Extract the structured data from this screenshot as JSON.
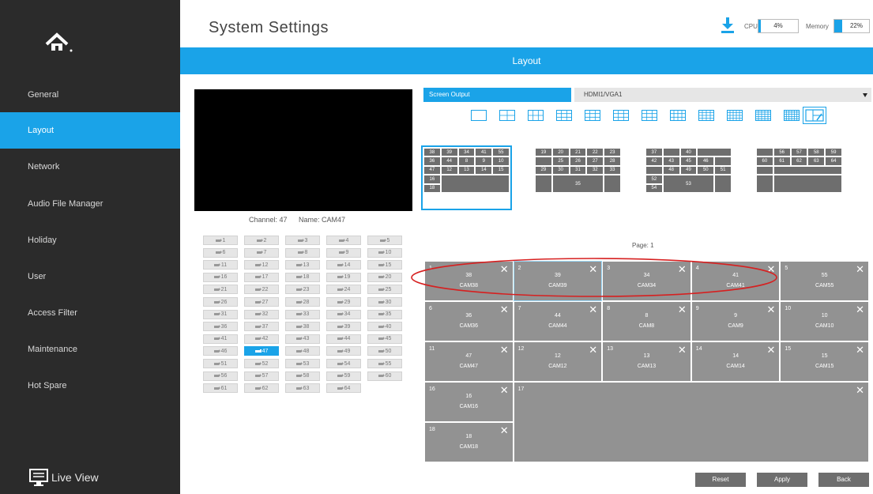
{
  "sidebar": {
    "items": [
      {
        "label": "General"
      },
      {
        "label": "Layout",
        "active": true
      },
      {
        "label": "Network"
      },
      {
        "label": "Audio File Manager"
      },
      {
        "label": "Holiday"
      },
      {
        "label": "User"
      },
      {
        "label": "Access Filter"
      },
      {
        "label": "Maintenance"
      },
      {
        "label": "Hot Spare"
      }
    ],
    "live_view_label": "Live View"
  },
  "header": {
    "title": "System Settings",
    "cpu_label": "CPU",
    "cpu_value": "4%",
    "cpu_fraction": 0.04,
    "memory_label": "Memory",
    "memory_value": "22%",
    "memory_fraction": 0.22
  },
  "banner": {
    "title": "Layout"
  },
  "preview": {
    "channel_label": "Channel: 47",
    "name_label": "Name: CAM47"
  },
  "channels": [
    "1",
    "2",
    "3",
    "4",
    "5",
    "6",
    "7",
    "8",
    "9",
    "10",
    "11",
    "12",
    "13",
    "14",
    "15",
    "16",
    "17",
    "18",
    "19",
    "20",
    "21",
    "22",
    "23",
    "24",
    "25",
    "26",
    "27",
    "28",
    "29",
    "30",
    "31",
    "32",
    "33",
    "34",
    "35",
    "36",
    "37",
    "38",
    "39",
    "40",
    "41",
    "42",
    "43",
    "44",
    "45",
    "46",
    "47",
    "48",
    "49",
    "50",
    "51",
    "52",
    "53",
    "54",
    "55",
    "56",
    "57",
    "58",
    "59",
    "60",
    "61",
    "62",
    "63",
    "64"
  ],
  "selected_channel": "47",
  "screen_output": {
    "label": "Screen Output",
    "value": "HDMI1/VGA1"
  },
  "mini_layouts": [
    [
      "38",
      "39",
      "34",
      "41",
      "55",
      "36",
      "44",
      "8",
      "9",
      "10",
      "47",
      "12",
      "13",
      "14",
      "15",
      "16",
      "18"
    ],
    [
      "19",
      "20",
      "21",
      "22",
      "23",
      "25",
      "26",
      "27",
      "28",
      "29",
      "30",
      "31",
      "32",
      "33",
      "35"
    ],
    [
      "37",
      "40",
      "42",
      "43",
      "45",
      "46",
      "48",
      "49",
      "50",
      "51",
      "52",
      "54",
      "53"
    ],
    [
      "56",
      "57",
      "58",
      "59",
      "60",
      "61",
      "62",
      "63",
      "64"
    ]
  ],
  "page_label": "Page: 1",
  "tiles": [
    {
      "index": "1",
      "channel": "38",
      "name": "CAM38"
    },
    {
      "index": "2",
      "channel": "39",
      "name": "CAM39"
    },
    {
      "index": "3",
      "channel": "34",
      "name": "CAM34"
    },
    {
      "index": "4",
      "channel": "41",
      "name": "CAM41"
    },
    {
      "index": "5",
      "channel": "55",
      "name": "CAM55"
    },
    {
      "index": "6",
      "channel": "36",
      "name": "CAM36"
    },
    {
      "index": "7",
      "channel": "44",
      "name": "CAM44"
    },
    {
      "index": "8",
      "channel": "8",
      "name": "CAM8"
    },
    {
      "index": "9",
      "channel": "9",
      "name": "CAM9"
    },
    {
      "index": "10",
      "channel": "10",
      "name": "CAM10"
    },
    {
      "index": "11",
      "channel": "47",
      "name": "CAM47"
    },
    {
      "index": "12",
      "channel": "12",
      "name": "CAM12"
    },
    {
      "index": "13",
      "channel": "13",
      "name": "CAM13"
    },
    {
      "index": "14",
      "channel": "14",
      "name": "CAM14"
    },
    {
      "index": "15",
      "channel": "15",
      "name": "CAM15"
    },
    {
      "index": "16",
      "channel": "16",
      "name": "CAM16"
    },
    {
      "index": "17",
      "channel": "",
      "name": ""
    },
    {
      "index": "18",
      "channel": "18",
      "name": "CAM18"
    }
  ],
  "tile_close_glyph": "✕",
  "buttons": {
    "reset": "Reset",
    "apply": "Apply",
    "back": "Back"
  },
  "colors": {
    "accent": "#1aa3e8",
    "sidebar": "#2b2b2b",
    "tile": "#929292",
    "annotation": "#d62020"
  }
}
